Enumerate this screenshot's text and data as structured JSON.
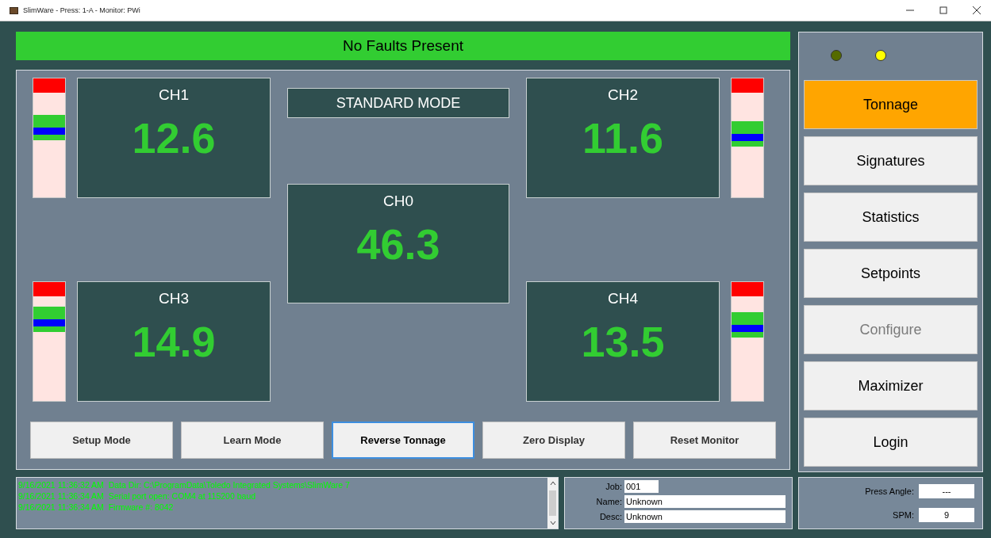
{
  "window": {
    "title": "SlimWare - Press: 1-A - Monitor: PWi"
  },
  "fault_banner": "No Faults Present",
  "mode": "STANDARD MODE",
  "channels": [
    {
      "label": "CH1",
      "value": "12.6",
      "level": 0.56
    },
    {
      "label": "CH2",
      "value": "11.6",
      "level": 0.51
    },
    {
      "label": "CH3",
      "value": "14.9",
      "level": 0.66
    },
    {
      "label": "CH4",
      "value": "13.5",
      "level": 0.61
    }
  ],
  "center_channel": {
    "label": "CH0",
    "value": "46.3"
  },
  "action_buttons": [
    {
      "label": "Setup Mode",
      "selected": false
    },
    {
      "label": "Learn Mode",
      "selected": false
    },
    {
      "label": "Reverse Tonnage",
      "selected": true
    },
    {
      "label": "Zero Display",
      "selected": false
    },
    {
      "label": "Reset Monitor",
      "selected": false
    }
  ],
  "indicators": [
    {
      "on": false
    },
    {
      "on": true
    }
  ],
  "nav": [
    {
      "label": "Tonnage",
      "selected": true,
      "disabled": false
    },
    {
      "label": "Signatures",
      "selected": false,
      "disabled": false
    },
    {
      "label": "Statistics",
      "selected": false,
      "disabled": false
    },
    {
      "label": "Setpoints",
      "selected": false,
      "disabled": false
    },
    {
      "label": "Configure",
      "selected": false,
      "disabled": true
    },
    {
      "label": "Maximizer",
      "selected": false,
      "disabled": false
    },
    {
      "label": "Login",
      "selected": false,
      "disabled": false
    }
  ],
  "log": [
    "9/16/2021 11:36:32 AM  Data Dir: C:\\ProgramData\\Toledo Integrated Systems\\SlimWare 7",
    "9/16/2021 11:36:34 AM  Serial port open: COM4 at 115200 baud",
    "9/16/2021 11:36:34 AM  Firmware #: 8042"
  ],
  "job": {
    "fields": [
      {
        "label": "Job:",
        "value": "001",
        "kind": "short"
      },
      {
        "label": "Name:",
        "value": "Unknown",
        "kind": "long"
      },
      {
        "label": "Desc:",
        "value": "Unknown",
        "kind": "long"
      }
    ]
  },
  "press": {
    "fields": [
      {
        "label": "Press Angle:",
        "value": "---"
      },
      {
        "label": "SPM:",
        "value": "9"
      }
    ]
  }
}
